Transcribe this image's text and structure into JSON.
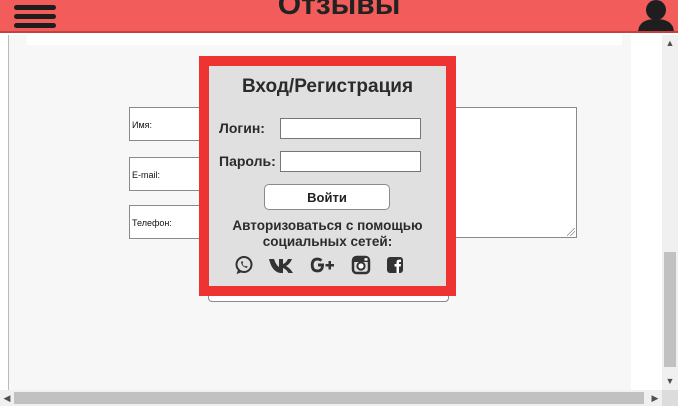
{
  "header": {
    "title": "Отзывы",
    "menu_icon": "hamburger-menu-icon",
    "user_icon": "user-icon",
    "background_color": "#f25d5b"
  },
  "feedback_form": {
    "fields": [
      {
        "label": "Имя:"
      },
      {
        "label": "E-mail:"
      },
      {
        "label": "Телефон:"
      }
    ]
  },
  "login_modal": {
    "title": "Вход/Регистрация",
    "login_label": "Логин:",
    "login_value": "",
    "password_label": "Пароль:",
    "password_value": "",
    "submit_label": "Войти",
    "social_text": "Авторизоваться с помощью социальных сетей:",
    "social_icons": [
      "whatsapp-icon",
      "vk-icon",
      "google-plus-icon",
      "instagram-icon",
      "facebook-icon"
    ],
    "border_color": "#ee3333",
    "background_color": "#e0e0e0"
  },
  "scrollbars": {
    "vertical_arrows": [
      "▲",
      "▼"
    ],
    "horizontal_arrows": [
      "◀",
      "▶"
    ]
  }
}
